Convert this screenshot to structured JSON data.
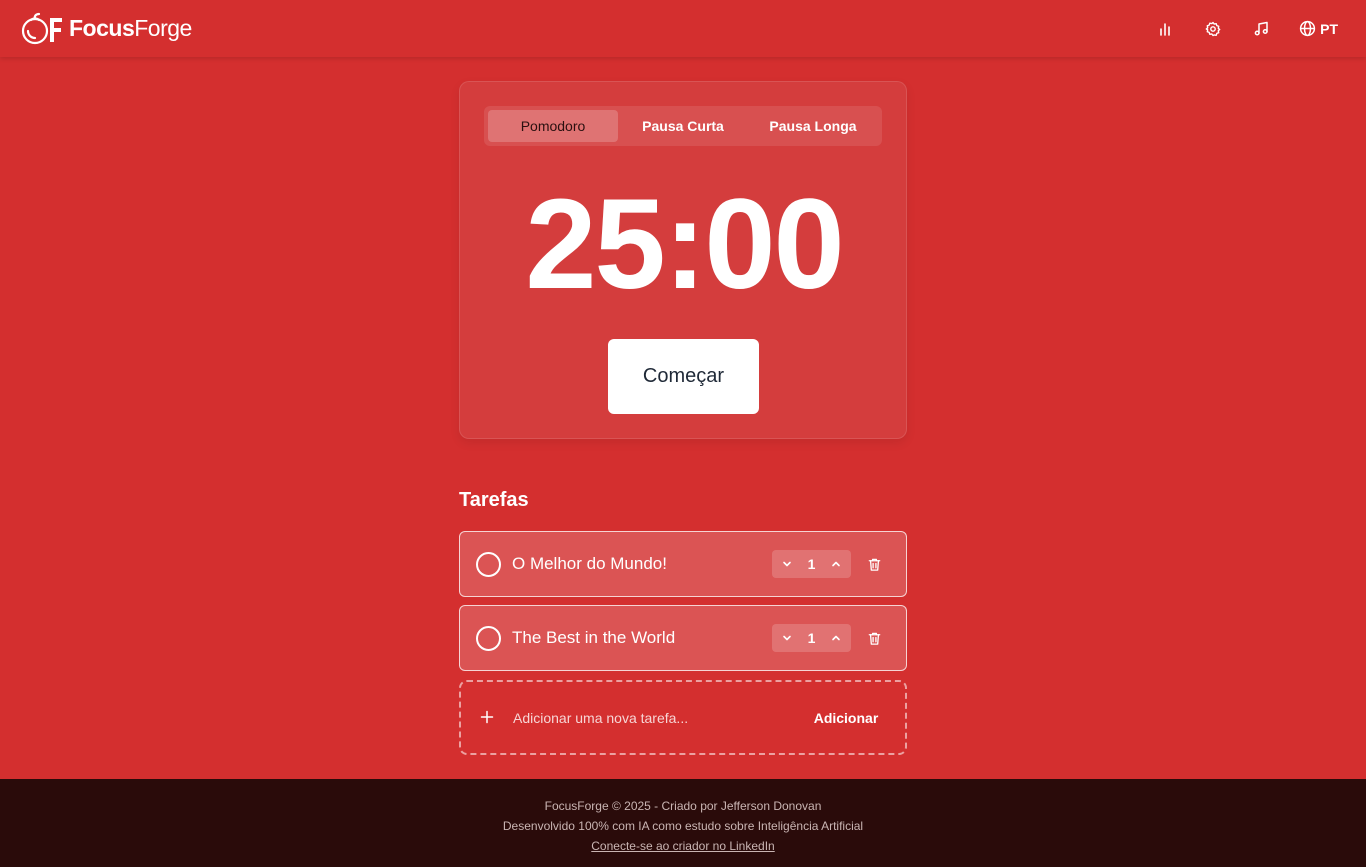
{
  "header": {
    "brand_part1": "Focus",
    "brand_part2": "Forge",
    "language": "PT"
  },
  "timer": {
    "tabs": [
      {
        "label": "Pomodoro",
        "active": true
      },
      {
        "label": "Pausa Curta",
        "active": false
      },
      {
        "label": "Pausa Longa",
        "active": false
      }
    ],
    "time": "25:00",
    "start_label": "Começar"
  },
  "tasks": {
    "title": "Tarefas",
    "items": [
      {
        "title": "O Melhor do Mundo!",
        "count": "1"
      },
      {
        "title": "The Best in the World",
        "count": "1"
      }
    ],
    "add_placeholder": "Adicionar uma nova tarefa...",
    "add_label": "Adicionar"
  },
  "footer": {
    "line1": "FocusForge © 2025 - Criado por Jefferson Donovan",
    "line2": "Desenvolvido 100% com IA como estudo sobre Inteligência Artificial",
    "link": "Conecte-se ao criador no LinkedIn"
  },
  "colors": {
    "background": "#d42f2f",
    "footer": "#2a0b0a",
    "button": "#ffffff"
  }
}
